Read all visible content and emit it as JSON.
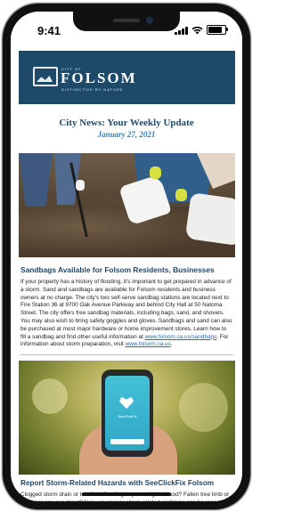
{
  "status": {
    "time": "9:41"
  },
  "banner": {
    "city_label": "CITY OF",
    "name": "FOLSOM",
    "tagline": "DISTINCTIVE BY NATURE"
  },
  "header": {
    "title": "City News: Your Weekly Update",
    "date": "January 27, 2021"
  },
  "article1": {
    "title": "Sandbags Available for Folsom Residents, Businesses",
    "body": "If your property has a history of flooding, it's important to get prepared in advance of a storm. Sand and sandbags are available for Folsom residents and business owners at no charge. The city's two self-serve sandbag stations are located next to Fire Station 36 at 9700 Oak Avenue Parkway and behind City Hall at 50 Natoma Street. The city offers free sandbag materials, including bags, sand, and shovels. You may also wish to bring safety goggles and gloves. Sandbags and sand can also be purchased at most major hardware or home improvement stores. Learn how to fill a sandbag and find other useful information at ",
    "link1": "www.folsom.ca.us/sandbags",
    "mid": ". For information about storm preparation, visit ",
    "link2": "www.folsom.ca.us",
    "end": "."
  },
  "article2": {
    "app_label": "SeeClickFix",
    "title": "Report Storm-Related Hazards with SeeClickFix Folsom",
    "body": "Clogged storm drain or localized flooding in your neighborhood? Fallen tree limb or stop sign on your street? Non-emergency storm-related problems can be reported"
  },
  "colors": {
    "banner": "#1c4a68",
    "heading": "#23496a",
    "date": "#3b7fb8",
    "link": "#2b6db8"
  }
}
